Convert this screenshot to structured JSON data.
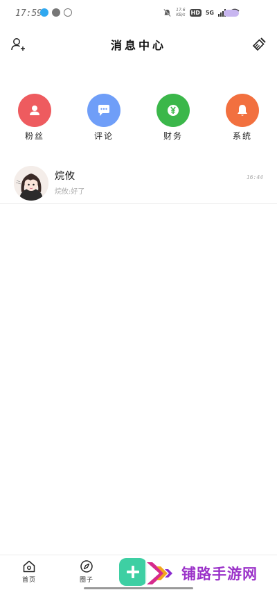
{
  "status_bar": {
    "time": "17:59",
    "net_speed_value": "17.6",
    "net_speed_unit": "KB/s",
    "hd_label": "HD",
    "network_label": "5G"
  },
  "header": {
    "title": "消息中心"
  },
  "categories": [
    {
      "label": "粉丝",
      "icon": "user-icon",
      "color": "#ee5b5f"
    },
    {
      "label": "评论",
      "icon": "comment-icon",
      "color": "#6f9ef8"
    },
    {
      "label": "财务",
      "icon": "yuan-icon",
      "color": "#3bb74a"
    },
    {
      "label": "系统",
      "icon": "bell-icon",
      "color": "#f2703f"
    }
  ],
  "messages": [
    {
      "name": "烷攸",
      "preview": "烷攸:好了",
      "time": "16:44"
    }
  ],
  "bottom_nav": {
    "home_label": "首页",
    "circle_label": "圈子"
  },
  "watermark": {
    "text": "铺路手游网"
  },
  "colors": {
    "accent": "#3ecfa3",
    "watermark": "#9b33c9"
  }
}
